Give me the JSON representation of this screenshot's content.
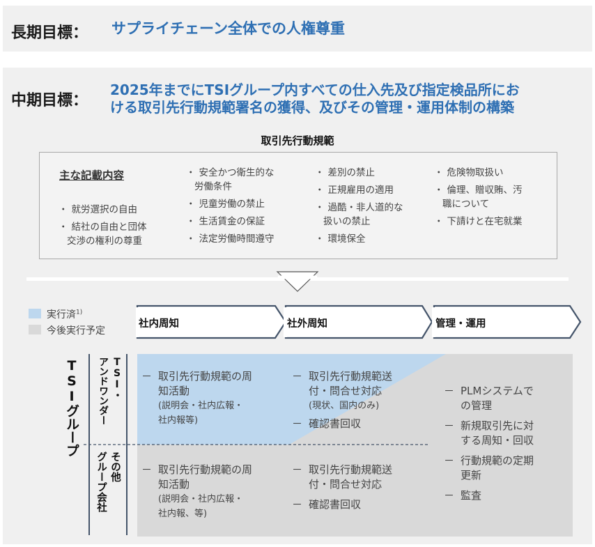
{
  "long_term": {
    "label": "長期目標：",
    "text": "サプライチェーン全体での人権尊重"
  },
  "mid_term": {
    "label": "中期目標：",
    "line1": "2025年までにTSIグループ内すべての仕入先及び指定検品所にお",
    "line2": "ける取引先行動規範署名の獲得、及びその管理・運用体制の構築"
  },
  "code": {
    "title": "取引先行動規範",
    "main_label": "主な記載内容",
    "col1": [
      "就労選択の自由",
      "結社の自由と団体",
      "交渉の権利の尊重"
    ],
    "col2": [
      "安全かつ衛生的な",
      "労働条件",
      "児童労働の禁止",
      "生活賃金の保証",
      "法定労働時間遵守"
    ],
    "col3": [
      "差別の禁止",
      "正規雇用の適用",
      "過酷・非人道的な",
      "扱いの禁止",
      "環境保全"
    ],
    "col4": [
      "危険物取扱い",
      "倫理、贈収賄、汚",
      "職について",
      "下請けと在宅就業"
    ]
  },
  "legend": {
    "done": "実行済",
    "done_sup": "1)",
    "planned": "今後実行予定",
    "done_color": "#bdd7ee",
    "planned_color": "#d9d9d9"
  },
  "stages": [
    "社内周知",
    "社外周知",
    "管理・運用"
  ],
  "groups": {
    "outer": "TSIグループ",
    "tsi_a": "TSI・",
    "tsi_b": "アンドワンダー",
    "other_a": "その他",
    "other_b": "グループ会社"
  },
  "cells": {
    "r1c1": {
      "l1": "取引先行動規範の周",
      "l2": "知活動",
      "s1": "(説明会・社内広報・",
      "s2": "社内報等)"
    },
    "r1c2": {
      "l1": "取引先行動規範送",
      "l2": "付・問合せ対応",
      "s1": "(現状、国内のみ)",
      "i2": "確認書回収"
    },
    "r2c1": {
      "l1": "取引先行動規範の周",
      "l2": "知活動",
      "s1": "(説明会・社内広報・",
      "s2": "社内報、等)"
    },
    "r2c2": {
      "l1": "取引先行動規範送",
      "l2": "付・問合せ対応",
      "i2": "確認書回収"
    },
    "c3": {
      "a1": "PLMシステムで",
      "a2": "の管理",
      "b1": "新規取引先に対",
      "b2": "する周知・回収",
      "c1": "行動規範の定期",
      "c2": "更新",
      "d1": "監査"
    }
  },
  "dash": "－",
  "bullet": "・"
}
